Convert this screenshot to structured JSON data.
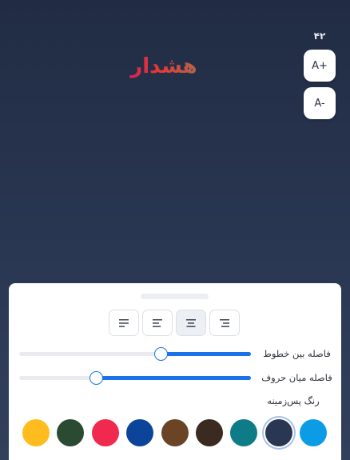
{
  "font_size": {
    "value": "۴۲",
    "increase_label": "A+",
    "decrease_label": "A-"
  },
  "preview": {
    "text": "هشدار"
  },
  "panel": {
    "alignment_options": [
      {
        "icon": "align-right-icon",
        "active": false
      },
      {
        "icon": "align-center-icon",
        "active": true
      },
      {
        "icon": "align-left-icon",
        "active": false
      },
      {
        "icon": "align-justify-icon",
        "active": false
      }
    ],
    "line_spacing": {
      "label": "فاصله بین خطوط",
      "fill_fraction": 0.39
    },
    "letter_spacing": {
      "label": "فاصله میان حروف",
      "fill_fraction": 0.67
    },
    "background_color_label": "رنگ پس‌زمینه",
    "background_colors": [
      {
        "name": "blue",
        "color": "#0c9ce6",
        "selected": false
      },
      {
        "name": "dark-navy",
        "color": "#2a3752",
        "selected": true
      },
      {
        "name": "teal",
        "color": "#0e7c86",
        "selected": false
      },
      {
        "name": "dark-brown",
        "color": "#3a2a20",
        "selected": false
      },
      {
        "name": "brown",
        "color": "#6b4426",
        "selected": false
      },
      {
        "name": "navy-blue",
        "color": "#0b4499",
        "selected": false
      },
      {
        "name": "crimson",
        "color": "#f0294f",
        "selected": false
      },
      {
        "name": "dark-green",
        "color": "#2a4a32",
        "selected": false
      },
      {
        "name": "amber",
        "color": "#ffbc1f",
        "selected": false
      }
    ]
  },
  "colors": {
    "accent": "#1a73e8"
  }
}
